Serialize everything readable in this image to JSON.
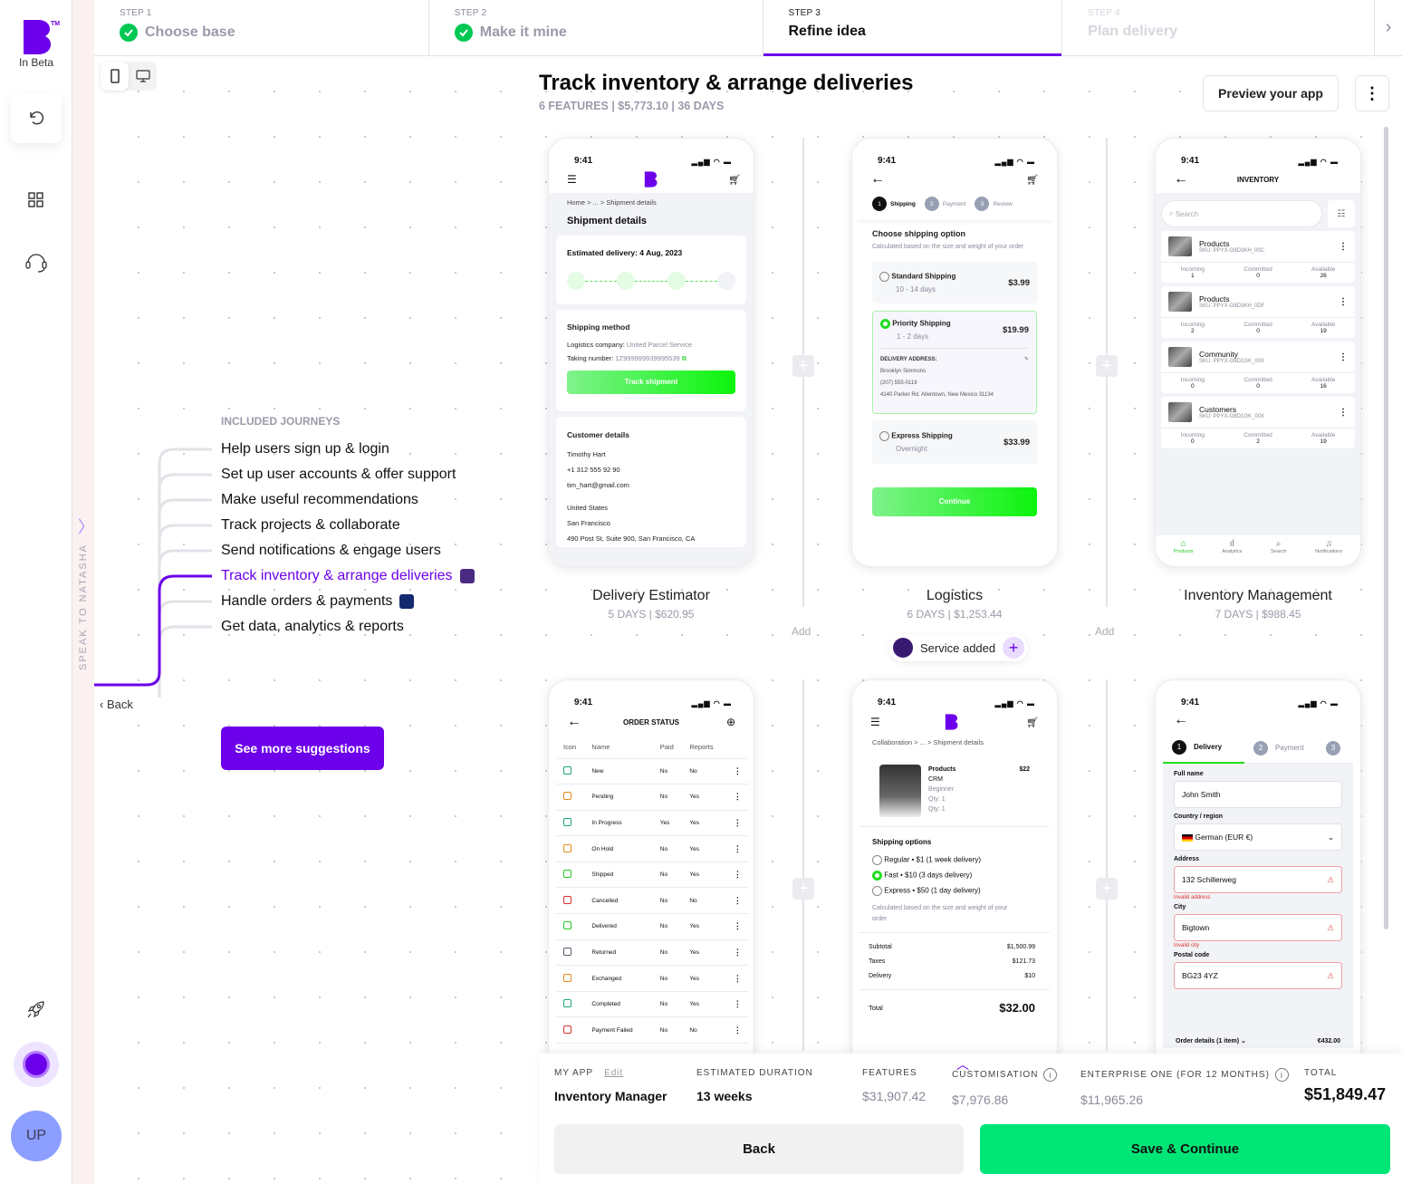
{
  "rail": {
    "logo": "B",
    "beta_label": "In Beta",
    "avatar_initials": "UP",
    "icons": [
      "undo-icon",
      "grid-icon",
      "headset-icon",
      "rocket-icon"
    ]
  },
  "speak_to": "SPEAK TO NATASHA",
  "stepper": {
    "steps": [
      {
        "label": "STEP 1",
        "title": "Choose base",
        "state": "done"
      },
      {
        "label": "STEP 2",
        "title": "Make it mine",
        "state": "done"
      },
      {
        "label": "STEP 3",
        "title": "Refine idea",
        "state": "active"
      },
      {
        "label": "STEP 4",
        "title": "Plan delivery",
        "state": "future"
      }
    ]
  },
  "header": {
    "title": "Track inventory & arrange deliveries",
    "subtitle": "6 FEATURES | $5,773.10 | 36 DAYS",
    "preview_label": "Preview your app",
    "more_label": "⋮"
  },
  "journeys": {
    "heading": "INCLUDED JOURNEYS",
    "items": [
      {
        "label": "Help users sign up & login"
      },
      {
        "label": "Set up user accounts & offer support"
      },
      {
        "label": "Make useful recommendations"
      },
      {
        "label": "Track projects & collaborate"
      },
      {
        "label": "Send notifications & engage users"
      },
      {
        "label": "Track inventory & arrange deliveries",
        "active": true
      },
      {
        "label": "Handle orders & payments"
      },
      {
        "label": "Get data, analytics & reports"
      }
    ],
    "back_label": "Back",
    "see_more_label": "See more suggestions"
  },
  "features": [
    {
      "name": "Delivery Estimator",
      "meta": "5 DAYS | $620.95"
    },
    {
      "name": "Logistics",
      "meta": "6 DAYS | $1,253.44"
    },
    {
      "name": "Inventory Management",
      "meta": "7 DAYS | $988.45"
    }
  ],
  "add_label": "Add",
  "service_added_label": "Service added",
  "phones": {
    "time": "9:41",
    "p1": {
      "breadcrumb": "Home  >  ...  >  Shipment details",
      "heading": "Shipment details",
      "est": "Estimated delivery: 4 Aug, 2023",
      "ship_method": "Shipping method",
      "logistics_label": "Logistics company:",
      "logistics_value": "United Parcel Service",
      "tracking_label": "Taking number:",
      "tracking_value": "1Z999999939995539",
      "track_btn": "Track shipment",
      "customer_heading": "Customer details",
      "customer_lines": [
        "Timothy Hart",
        "+1 312 555 92 90",
        "tim_hart@gmail.com"
      ],
      "address_lines": [
        "United States",
        "San Francisco",
        "490 Post St, Suite 900, San Francisco, CA"
      ]
    },
    "p2": {
      "steps": [
        "Shipping",
        "Payment",
        "Review"
      ],
      "heading": "Choose shipping option",
      "desc": "Calculated based on the size and weight of your order",
      "options": [
        {
          "name": "Standard Shipping",
          "eta": "10 - 14 days",
          "price": "$3.99",
          "selected": false
        },
        {
          "name": "Priority Shipping",
          "eta": "1 - 2 days",
          "price": "$19.99",
          "selected": true
        },
        {
          "name": "Express Shipping",
          "eta": "Overnight",
          "price": "$33.99",
          "selected": false
        }
      ],
      "addr_label": "DELIVERY ADDRESS:",
      "addr_lines": [
        "Brooklyn Simmons",
        "(207) 555-0119",
        "4140 Parker Rd. Allentown, New Mexico 31134"
      ],
      "continue_btn": "Continue"
    },
    "p3": {
      "title": "INVENTORY",
      "search_placeholder": "Search",
      "items": [
        {
          "name": "Products",
          "sku": "SKU: PPYX-O8D3KH_00C",
          "incoming": "1",
          "committed": "0",
          "available": "26"
        },
        {
          "name": "Products",
          "sku": "SKU: PPYX-O8D3KH_0DF",
          "incoming": "2",
          "committed": "0",
          "available": "19"
        },
        {
          "name": "Community",
          "sku": "SKU: PPYX-O8D1GK_00X",
          "incoming": "0",
          "committed": "0",
          "available": "16"
        },
        {
          "name": "Customers",
          "sku": "SKU: PPYX-O8D1GK_00X",
          "incoming": "0",
          "committed": "2",
          "available": "19"
        }
      ],
      "stat_labels": [
        "Incoming",
        "Committed",
        "Available"
      ],
      "nav": [
        "Products",
        "Analytics",
        "Search",
        "Notifications"
      ]
    },
    "p4": {
      "title": "ORDER STATUS",
      "columns": [
        "Icon",
        "Name",
        "Paid",
        "Reports"
      ],
      "rows": [
        {
          "name": "New",
          "paid": "No",
          "reports": "No",
          "color": "#1aa37a"
        },
        {
          "name": "Pending",
          "paid": "No",
          "reports": "Yes",
          "color": "#e8891a"
        },
        {
          "name": "In Progress",
          "paid": "Yes",
          "reports": "Yes",
          "color": "#1aa37a"
        },
        {
          "name": "On Hold",
          "paid": "No",
          "reports": "Yes",
          "color": "#e8891a"
        },
        {
          "name": "Shipped",
          "paid": "No",
          "reports": "Yes",
          "color": "#22cc22"
        },
        {
          "name": "Cancelled",
          "paid": "No",
          "reports": "No",
          "color": "#d83030"
        },
        {
          "name": "Delivered",
          "paid": "No",
          "reports": "Yes",
          "color": "#22cc22"
        },
        {
          "name": "Returned",
          "paid": "No",
          "reports": "Yes",
          "color": "#556070"
        },
        {
          "name": "Exchanged",
          "paid": "No",
          "reports": "Yes",
          "color": "#e8891a"
        },
        {
          "name": "Completed",
          "paid": "No",
          "reports": "Yes",
          "color": "#1aa37a"
        },
        {
          "name": "Payment Failed",
          "paid": "No",
          "reports": "No",
          "color": "#d83030"
        }
      ]
    },
    "p5": {
      "breadcrumb": "Collaboration  >  ...  >  Shipment details",
      "product": {
        "name": "Products",
        "price": "$22",
        "sub": "CRM",
        "level": "Beginner",
        "qty1": "Qty: 1",
        "qty2": "Qty: 1"
      },
      "ship_heading": "Shipping options",
      "options": [
        {
          "label": "Regular • $1 (1 week delivery)",
          "selected": false
        },
        {
          "label": "Fast • $10 (3 days delivery)",
          "selected": true
        },
        {
          "label": "Express • $50 (1 day delivery)",
          "selected": false
        }
      ],
      "desc": "Calculated based on the size and weight of your order",
      "subtotal_label": "Subtotal",
      "subtotal": "$1,500.99",
      "taxes_label": "Taxes",
      "taxes": "$121.73",
      "delivery_label": "Delivery",
      "delivery": "$10",
      "total_label": "Total",
      "total": "$32.00"
    },
    "p6": {
      "tabs": [
        {
          "n": "1",
          "label": "Delivery"
        },
        {
          "n": "2",
          "label": "Payment"
        },
        {
          "n": "3",
          "label": ""
        }
      ],
      "fullname_label": "Full name",
      "fullname": "John Smith",
      "country_label": "Country / region",
      "country": "German (EUR €)",
      "address_label": "Address",
      "address": "132 Schillerweg",
      "address_err": "Invalid address",
      "city_label": "City",
      "city": "Bigtown",
      "city_err": "Invalid city",
      "postal_label": "Postal code",
      "postal": "BG23 4YZ",
      "order_details": "Order details (1 item)",
      "order_total": "€432.00"
    }
  },
  "bottom": {
    "myapp_label": "MY APP",
    "edit_label": "Edit",
    "myapp_value": "Inventory Manager",
    "duration_label": "ESTIMATED DURATION",
    "duration_value": "13 weeks",
    "features_label": "FEATURES",
    "features_value": "$31,907.42",
    "custom_label": "CUSTOMISATION",
    "custom_value": "$7,976.86",
    "enterprise_label": "ENTERPRISE ONE (FOR 12 MONTHS)",
    "enterprise_value": "$11,965.26",
    "total_label": "TOTAL",
    "total_value": "$51,849.47",
    "back_label": "Back",
    "save_label": "Save & Continue"
  },
  "colors": {
    "brand": "#6c00ea",
    "success": "#00e676",
    "check": "#00c853"
  }
}
